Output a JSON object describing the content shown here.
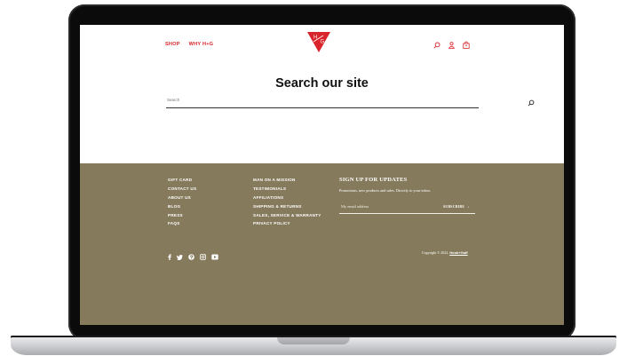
{
  "header": {
    "nav": [
      "SHOP",
      "WHY H+G"
    ],
    "logo_text": [
      "H",
      "G"
    ],
    "icons": [
      "search-icon",
      "account-icon",
      "cart-icon"
    ],
    "brand_color": "#d8242a"
  },
  "main": {
    "title": "Search our site",
    "search_placeholder": "Search"
  },
  "footer": {
    "background": "#857a5c",
    "col1": [
      "GIFT CARD",
      "CONTACT US",
      "ABOUT US",
      "BLOG",
      "PRESS",
      "FAQS"
    ],
    "col2": [
      "MAN ON A MISSION",
      "TESTIMONIALS",
      "AFFILIATIONS",
      "SHIPPING & RETURNS",
      "SALES, SERVICE & WARRANTY",
      "PRIVACY POLICY"
    ],
    "signup_title": "SIGN UP FOR UPDATES",
    "signup_text": "Promotions, new products and sales. Directly to your inbox.",
    "email_placeholder": "My email address",
    "subscribe_label": "SUBSCRIBE",
    "subscribe_arrow": "›",
    "social_icons": [
      "facebook-icon",
      "twitter-icon",
      "pinterest-icon",
      "instagram-icon",
      "youtube-icon"
    ],
    "copyright_prefix": "Copyright © 2022,",
    "copyright_brand": "Hook+Gaff"
  }
}
